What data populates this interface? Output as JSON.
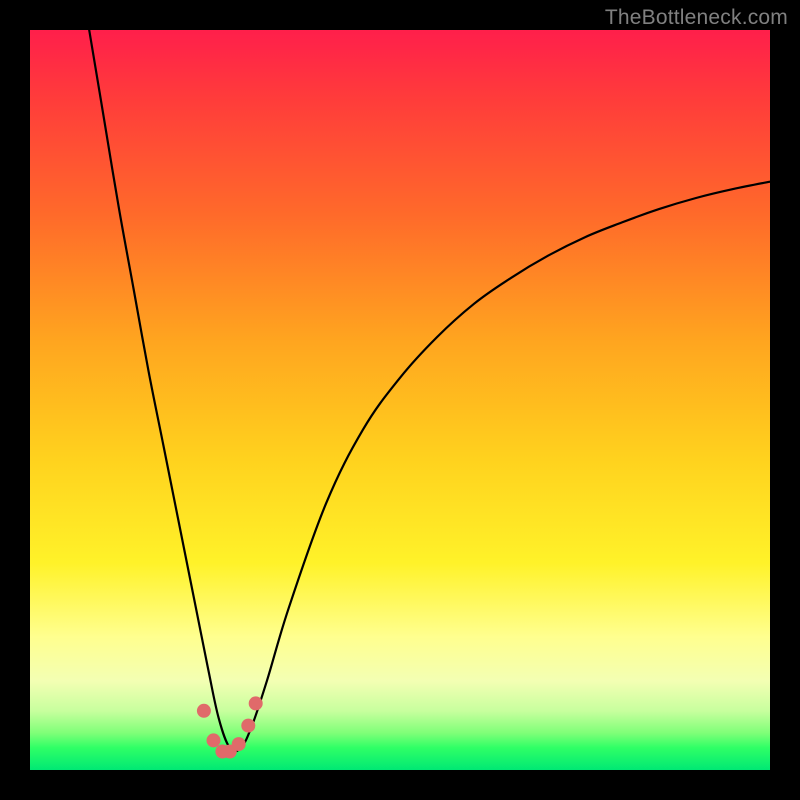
{
  "watermark": "TheBottleneck.com",
  "chart_data": {
    "type": "line",
    "title": "",
    "xlabel": "",
    "ylabel": "",
    "xlim": [
      0,
      100
    ],
    "ylim": [
      0,
      100
    ],
    "grid": false,
    "legend": false,
    "background_gradient": {
      "top_color": "#ff1f4b",
      "bottom_color": "#00e874"
    },
    "series": [
      {
        "name": "bottleneck-curve",
        "color": "#000000",
        "x": [
          8,
          10,
          12,
          14,
          16,
          18,
          20,
          22,
          24,
          25.5,
          27,
          28.5,
          30,
          32,
          35,
          40,
          45,
          50,
          55,
          60,
          65,
          70,
          75,
          80,
          85,
          90,
          95,
          100
        ],
        "y": [
          100,
          88,
          76,
          65,
          54,
          44,
          34,
          24,
          14,
          7,
          3,
          3,
          6,
          12,
          22,
          36,
          46,
          53,
          58.5,
          63,
          66.5,
          69.5,
          72,
          74,
          75.8,
          77.3,
          78.5,
          79.5
        ]
      }
    ],
    "markers": {
      "name": "trough-markers",
      "color": "#e06a6a",
      "points": [
        {
          "x": 23.5,
          "y": 8
        },
        {
          "x": 24.8,
          "y": 4
        },
        {
          "x": 26.0,
          "y": 2.5
        },
        {
          "x": 27.0,
          "y": 2.5
        },
        {
          "x": 28.2,
          "y": 3.5
        },
        {
          "x": 29.5,
          "y": 6
        },
        {
          "x": 30.5,
          "y": 9
        }
      ]
    }
  }
}
